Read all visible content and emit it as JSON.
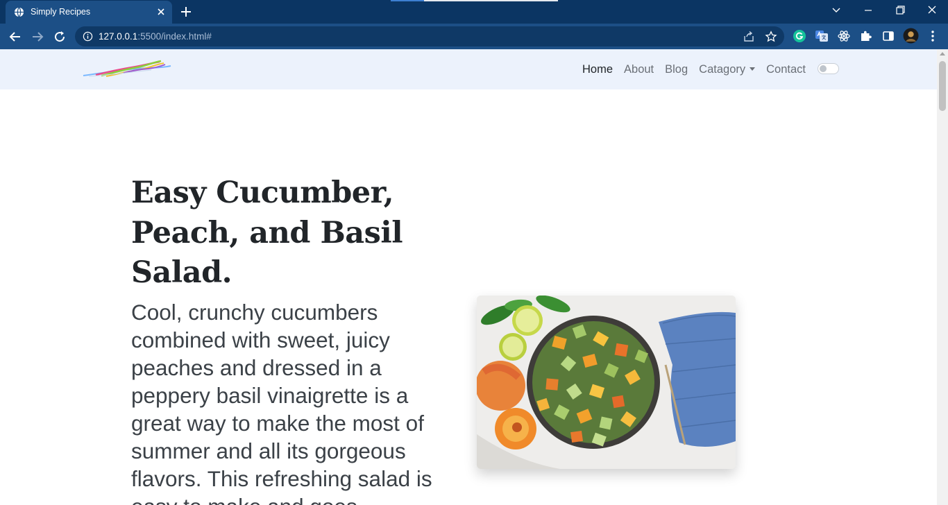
{
  "browser": {
    "tab_title": "Simply Recipes",
    "url_host": "127.0.0.1",
    "url_path": ":5500/index.html#"
  },
  "nav": {
    "items": [
      {
        "label": "Home"
      },
      {
        "label": "About"
      },
      {
        "label": "Blog"
      },
      {
        "label": "Catagory"
      },
      {
        "label": "Contact"
      }
    ]
  },
  "hero": {
    "title": "Easy Cucumber, Peach, and Basil Salad.",
    "description": "Cool, crunchy cucumbers combined with sweet, juicy peaches and dressed in a peppery basil vinaigrette is a great way to make the most of summer and all its gorgeous flavors. This refreshing salad is easy to make and goes"
  },
  "colors": {
    "tabbar": "#0b3563",
    "toolbar": "#1c4f86",
    "nav_bg": "#ecf2fc",
    "heading": "#212529"
  }
}
